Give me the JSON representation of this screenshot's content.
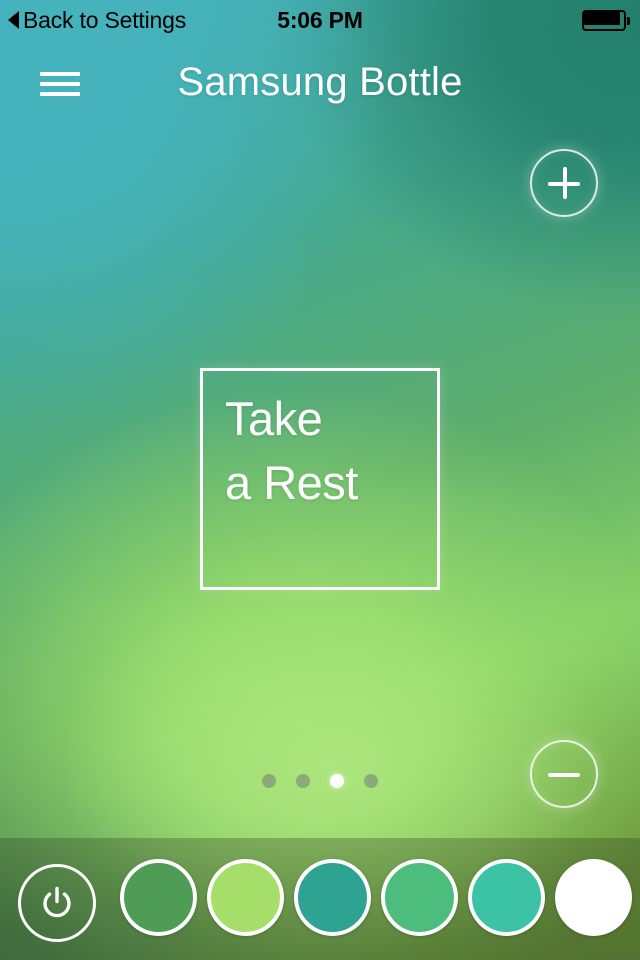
{
  "status_bar": {
    "back_label": "Back to Settings",
    "back_icon": "back-triangle-icon",
    "time": "5:06 PM",
    "battery_icon": "battery-full-icon",
    "battery_level": "100"
  },
  "header": {
    "menu_icon": "hamburger-menu-icon",
    "title": "Samsung Bottle"
  },
  "controls": {
    "plus_icon": "plus-circle-icon",
    "plus_label": "+",
    "minus_icon": "minus-circle-icon",
    "minus_label": "−"
  },
  "card": {
    "text": "Take\na Rest"
  },
  "pager": {
    "total": 4,
    "active_index": 2,
    "dots": [
      {
        "active": false
      },
      {
        "active": false
      },
      {
        "active": true
      },
      {
        "active": false
      }
    ]
  },
  "bottom_bar": {
    "power_icon": "power-icon",
    "power_label": "Power",
    "swatches": [
      {
        "name": "swatch-forest-green",
        "color": "#4f9c57"
      },
      {
        "name": "swatch-lime-green",
        "color": "#a5de68"
      },
      {
        "name": "swatch-teal-green",
        "color": "#2fa391"
      },
      {
        "name": "swatch-emerald-green",
        "color": "#4cbd7d"
      },
      {
        "name": "swatch-turquoise",
        "color": "#3cc3a5"
      },
      {
        "name": "swatch-white",
        "color": "#ffffff"
      }
    ]
  },
  "theme": {
    "bg_top_left": "#45b3bd",
    "bg_top_right": "#23806c",
    "bg_center_bottom": "#9ade6d",
    "bg_bottom_right": "#6f9a3e",
    "accent_white": "#ffffff"
  }
}
